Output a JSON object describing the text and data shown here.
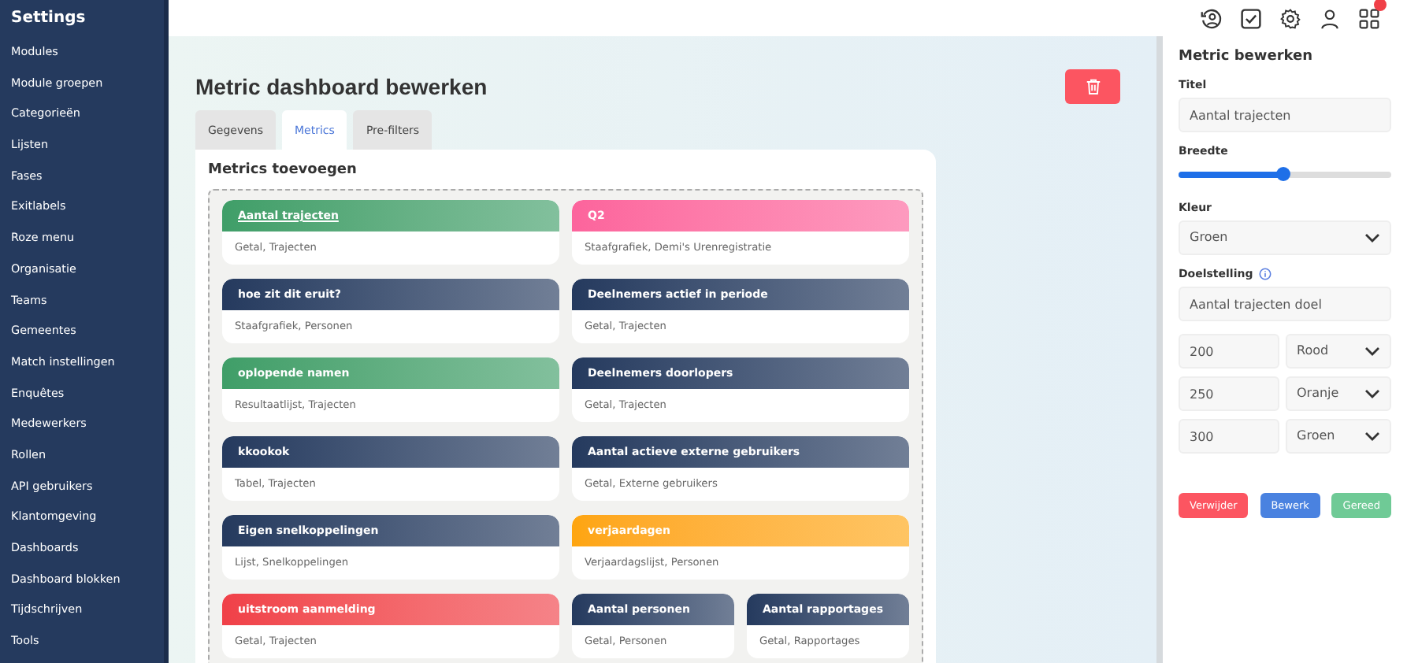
{
  "sidebar": {
    "title": "Settings",
    "items": [
      "Modules",
      "Module groepen",
      "Categorieën",
      "Lijsten",
      "Fases",
      "Exitlabels",
      "Roze menu",
      "Organisatie",
      "Teams",
      "Gemeentes",
      "Match instellingen",
      "Enquêtes",
      "Medewerkers",
      "Rollen",
      "API gebruikers",
      "Klantomgeving",
      "Dashboards",
      "Dashboard blokken",
      "Tijdschrijven",
      "Tools"
    ]
  },
  "topbar": {
    "notification_badge": true
  },
  "page": {
    "title": "Metric dashboard bewerken"
  },
  "tabs": [
    {
      "label": "Gegevens",
      "selected": false
    },
    {
      "label": "Metrics",
      "selected": true
    },
    {
      "label": "Pre-filters",
      "selected": false
    }
  ],
  "metrics_panel": {
    "title": "Metrics toevoegen",
    "cards": [
      {
        "title": "Aantal trajecten",
        "subtitle": "Getal, Trajecten",
        "color": "#3f9e68",
        "wide": true,
        "selected": true
      },
      {
        "title": "Q2",
        "subtitle": "Staafgrafiek, Demi's Urenregistratie",
        "color": "#fc649c",
        "wide": true,
        "selected": false
      },
      {
        "title": "hoe zit dit eruit?",
        "subtitle": "Staafgrafiek, Personen",
        "color": "#253a5e",
        "wide": true,
        "selected": false
      },
      {
        "title": "Deelnemers actief in periode",
        "subtitle": "Getal, Trajecten",
        "color": "#253a5e",
        "wide": true,
        "selected": false
      },
      {
        "title": "oplopende namen",
        "subtitle": "Resultaatlijst, Trajecten",
        "color": "#3f9e68",
        "wide": true,
        "selected": false
      },
      {
        "title": "Deelnemers doorlopers",
        "subtitle": "Getal, Trajecten",
        "color": "#253a5e",
        "wide": true,
        "selected": false
      },
      {
        "title": "kkookok",
        "subtitle": "Tabel, Trajecten",
        "color": "#253a5e",
        "wide": true,
        "selected": false
      },
      {
        "title": "Aantal actieve externe gebruikers",
        "subtitle": "Getal, Externe gebruikers",
        "color": "#253a5e",
        "wide": true,
        "selected": false
      },
      {
        "title": "Eigen snelkoppelingen",
        "subtitle": "Lijst, Snelkoppelingen",
        "color": "#253a5e",
        "wide": true,
        "selected": false
      },
      {
        "title": "verjaardagen",
        "subtitle": "Verjaardagslijst, Personen",
        "color": "#fea50f",
        "wide": true,
        "selected": false
      },
      {
        "title": "uitstroom aanmelding",
        "subtitle": "Getal, Trajecten",
        "color": "#f04048",
        "wide": true,
        "selected": false
      },
      {
        "title": "Aantal personen",
        "subtitle": "Getal, Personen",
        "color": "#253a5e",
        "wide": false,
        "selected": false
      },
      {
        "title": "Aantal rapportages",
        "subtitle": "Getal, Rapportages",
        "color": "#253a5e",
        "wide": false,
        "selected": false
      }
    ]
  },
  "editor": {
    "title": "Metric bewerken",
    "title_label": "Titel",
    "title_value": "Aantal trajecten",
    "width_label": "Breedte",
    "width": {
      "level": 0.49
    },
    "color_label": "Kleur",
    "color_value": "Groen",
    "goal_label": "Doelstelling",
    "goal_value": "Aantal trajecten doel",
    "thresholds": [
      {
        "value": "200",
        "color_name": "Rood"
      },
      {
        "value": "250",
        "color_name": "Oranje"
      },
      {
        "value": "300",
        "color_name": "Groen"
      }
    ],
    "buttons": [
      {
        "label": "Verwijder",
        "kind": "danger"
      },
      {
        "label": "Bewerk",
        "kind": "primary"
      },
      {
        "label": "Gereed",
        "kind": "success"
      }
    ]
  }
}
